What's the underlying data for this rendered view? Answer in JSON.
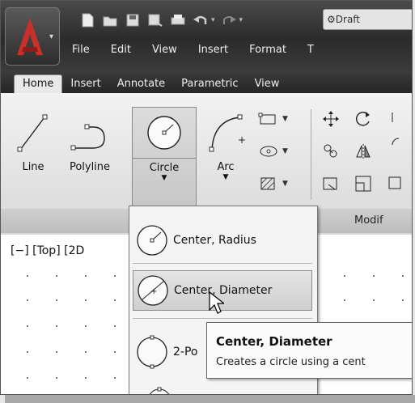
{
  "quick_access": {
    "workspace_label": "Draft",
    "icons": [
      "new-icon",
      "open-icon",
      "save-icon",
      "save-as-icon",
      "plot-icon",
      "undo-icon",
      "redo-icon",
      "workspace-gear-icon"
    ]
  },
  "menubar": {
    "items": [
      "File",
      "Edit",
      "View",
      "Insert",
      "Format",
      "T"
    ]
  },
  "ribbon_tabs": [
    "Home",
    "Insert",
    "Annotate",
    "Parametric",
    "View"
  ],
  "draw_tools": {
    "line": "Line",
    "polyline": "Polyline",
    "circle": "Circle",
    "arc": "Arc"
  },
  "modify_panel": {
    "title": "Modif"
  },
  "viewport": {
    "label": "[−] [Top] [2D"
  },
  "circle_dropdown": {
    "items": [
      {
        "label": "Center, Radius"
      },
      {
        "label": "Center, Diameter"
      },
      {
        "label": "2-Po"
      }
    ]
  },
  "tooltip": {
    "title": "Center, Diameter",
    "description": "Creates a circle using a cent"
  },
  "colors": {
    "title_dark": "#2b2b2b",
    "ribbon_light": "#e9e9e9",
    "highlight": "#d0d0d0"
  }
}
